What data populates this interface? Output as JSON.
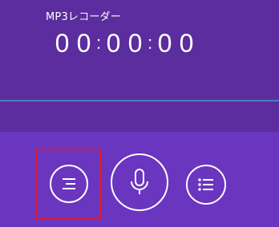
{
  "app": {
    "title": "MP3レコーダー"
  },
  "timer": {
    "digits": [
      "0",
      "0",
      "0",
      "0",
      "0",
      "0"
    ],
    "separator": ":"
  },
  "controls": [
    {
      "name": "menu-button",
      "icon": "hamburger-menu-icon"
    },
    {
      "name": "record-button",
      "icon": "microphone-icon"
    },
    {
      "name": "recordings-list-button",
      "icon": "list-icon"
    }
  ],
  "colors": {
    "top_background": "#5b2d9e",
    "bottom_background": "#6a35bf",
    "divider": "#4a7fbd",
    "foreground": "#ffffff",
    "highlight": "#e01a2b"
  }
}
